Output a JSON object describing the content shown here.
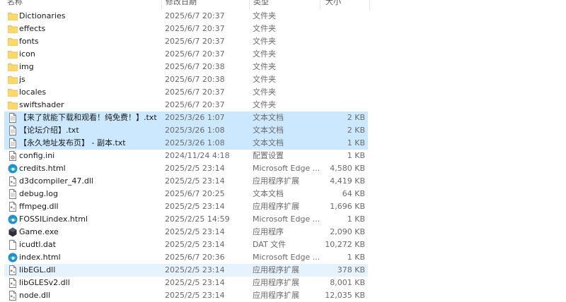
{
  "header": {
    "name": "名称",
    "date": "修改日期",
    "type": "类型",
    "size": "大小"
  },
  "rows": [
    {
      "name": "Dictionaries",
      "date": "2025/6/7 20:37",
      "type": "文件夹",
      "size": "",
      "icon": "folder-icon",
      "state": ""
    },
    {
      "name": "effects",
      "date": "2025/6/7 20:37",
      "type": "文件夹",
      "size": "",
      "icon": "folder-icon",
      "state": ""
    },
    {
      "name": "fonts",
      "date": "2025/6/7 20:37",
      "type": "文件夹",
      "size": "",
      "icon": "folder-icon",
      "state": ""
    },
    {
      "name": "icon",
      "date": "2025/6/7 20:37",
      "type": "文件夹",
      "size": "",
      "icon": "folder-icon",
      "state": ""
    },
    {
      "name": "img",
      "date": "2025/6/7 20:38",
      "type": "文件夹",
      "size": "",
      "icon": "folder-icon",
      "state": ""
    },
    {
      "name": "js",
      "date": "2025/6/7 20:38",
      "type": "文件夹",
      "size": "",
      "icon": "folder-icon",
      "state": ""
    },
    {
      "name": "locales",
      "date": "2025/6/7 20:37",
      "type": "文件夹",
      "size": "",
      "icon": "folder-icon",
      "state": ""
    },
    {
      "name": "swiftshader",
      "date": "2025/6/7 20:37",
      "type": "文件夹",
      "size": "",
      "icon": "folder-icon",
      "state": ""
    },
    {
      "name": "【来了就能下载和观看！纯免费！】.txt",
      "date": "2025/3/26 1:07",
      "type": "文本文档",
      "size": "2 KB",
      "icon": "text-file-icon",
      "state": "sel"
    },
    {
      "name": "【论坛介绍】.txt",
      "date": "2025/3/26 1:08",
      "type": "文本文档",
      "size": "2 KB",
      "icon": "text-file-icon",
      "state": "sel"
    },
    {
      "name": "【永久地址发布页】 - 副本.txt",
      "date": "2025/3/26 1:08",
      "type": "文本文档",
      "size": "1 KB",
      "icon": "text-file-icon",
      "state": "sel"
    },
    {
      "name": "config.ini",
      "date": "2024/11/24 4:18",
      "type": "配置设置",
      "size": "1 KB",
      "icon": "config-file-icon",
      "state": ""
    },
    {
      "name": "credits.html",
      "date": "2025/2/5 23:14",
      "type": "Microsoft Edge ...",
      "size": "4,580 KB",
      "icon": "edge-icon",
      "state": ""
    },
    {
      "name": "d3dcompiler_47.dll",
      "date": "2025/2/5 23:14",
      "type": "应用程序扩展",
      "size": "4,419 KB",
      "icon": "dll-file-icon",
      "state": ""
    },
    {
      "name": "debug.log",
      "date": "2025/6/7 20:25",
      "type": "文本文档",
      "size": "64 KB",
      "icon": "text-file-icon",
      "state": ""
    },
    {
      "name": "ffmpeg.dll",
      "date": "2025/2/5 23:14",
      "type": "应用程序扩展",
      "size": "1,696 KB",
      "icon": "dll-file-icon",
      "state": ""
    },
    {
      "name": "FOSSILindex.html",
      "date": "2025/2/25 14:59",
      "type": "Microsoft Edge ...",
      "size": "1 KB",
      "icon": "edge-icon",
      "state": ""
    },
    {
      "name": "Game.exe",
      "date": "2025/2/5 23:14",
      "type": "应用程序",
      "size": "2,090 KB",
      "icon": "exe-icon",
      "state": ""
    },
    {
      "name": "icudtl.dat",
      "date": "2025/2/5 23:14",
      "type": "DAT 文件",
      "size": "10,272 KB",
      "icon": "blank-file-icon",
      "state": ""
    },
    {
      "name": "index.html",
      "date": "2025/6/7 20:36",
      "type": "Microsoft Edge ...",
      "size": "1 KB",
      "icon": "edge-icon",
      "state": ""
    },
    {
      "name": "libEGL.dll",
      "date": "2025/2/5 23:14",
      "type": "应用程序扩展",
      "size": "378 KB",
      "icon": "dll-file-icon",
      "state": "hov"
    },
    {
      "name": "libGLESv2.dll",
      "date": "2025/2/5 23:14",
      "type": "应用程序扩展",
      "size": "8,001 KB",
      "icon": "dll-file-icon",
      "state": ""
    },
    {
      "name": "node.dll",
      "date": "2025/2/5 23:14",
      "type": "应用程序扩展",
      "size": "12,035 KB",
      "icon": "dll-file-icon",
      "state": ""
    }
  ]
}
